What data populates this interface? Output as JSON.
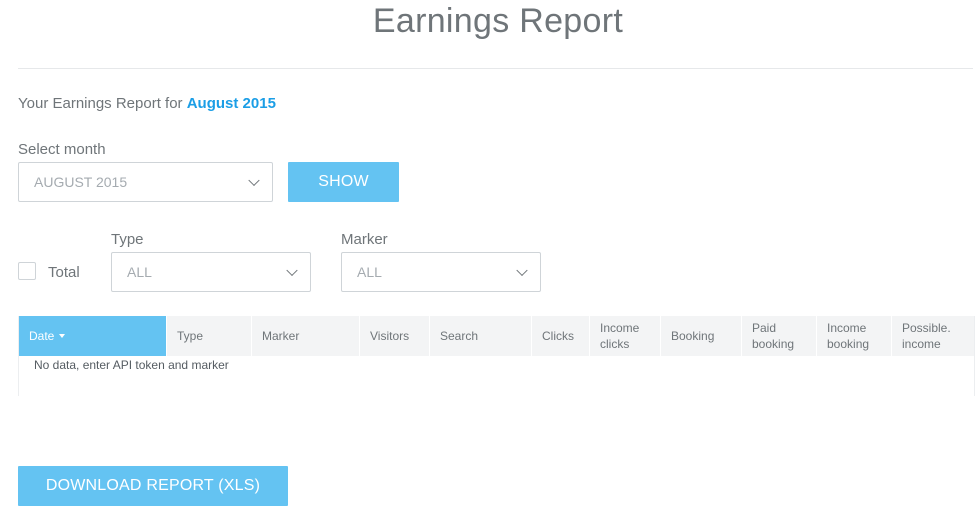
{
  "page": {
    "title": "Earnings Report"
  },
  "report": {
    "prefix": "Your Earnings Report for ",
    "period": "August 2015"
  },
  "month_select": {
    "label": "Select month",
    "value": "AUGUST 2015"
  },
  "show_button": {
    "label": "SHOW"
  },
  "filters": {
    "total_label": "Total",
    "type_label": "Type",
    "type_value": "ALL",
    "marker_label": "Marker",
    "marker_value": "ALL"
  },
  "table": {
    "columns": [
      "Date",
      "Type",
      "Marker",
      "Visitors",
      "Search",
      "Clicks",
      "Income clicks",
      "Booking",
      "Paid booking",
      "Income booking",
      "Possible. income"
    ],
    "empty_message": "No data, enter API token and marker"
  },
  "download_button": {
    "label": "DOWNLOAD REPORT (XLS)"
  },
  "colors": {
    "accent": "#64c3f2",
    "link": "#1b9ee6",
    "header_bg": "#f3f4f5"
  }
}
